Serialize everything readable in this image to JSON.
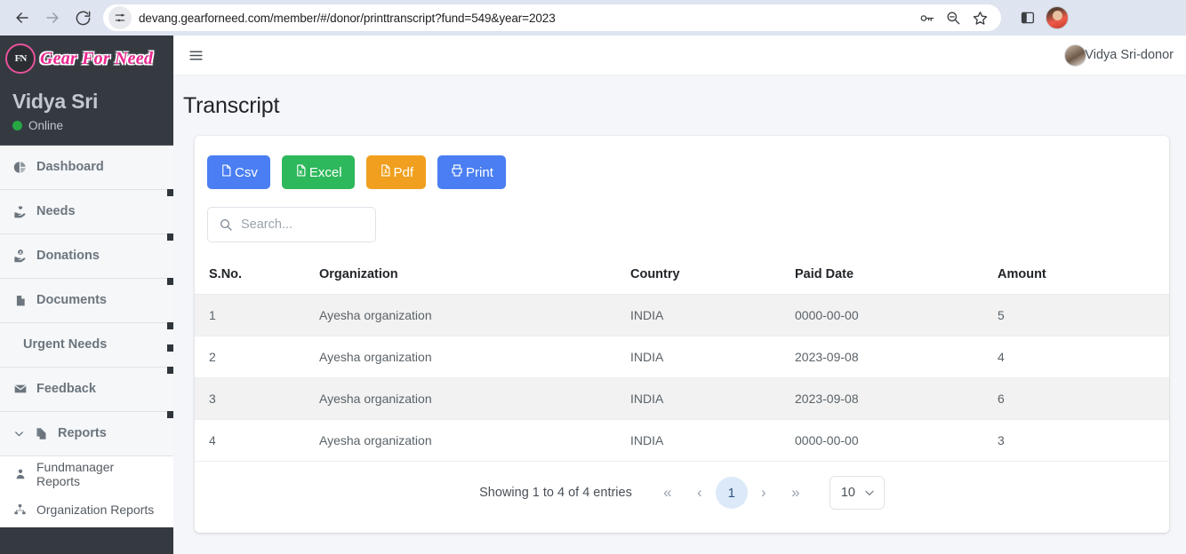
{
  "browser": {
    "url": "devang.gearforneed.com/member/#/donor/printtranscript?fund=549&year=2023",
    "back_icon": "back-arrow-icon",
    "forward_icon": "forward-arrow-icon",
    "reload_icon": "reload-icon",
    "site_settings_icon": "site-settings-icon",
    "password_icon": "password-key-icon",
    "zoom_icon": "zoom-icon",
    "bookmark_icon": "bookmark-star-icon",
    "sidepanel_icon": "side-panel-icon",
    "profile_icon": "profile-avatar-icon"
  },
  "sidebar": {
    "brand": {
      "badge": "FN",
      "name": "Gear For Need"
    },
    "user": {
      "name": "Vidya Sri",
      "status": "Online"
    },
    "items": [
      {
        "label": "Dashboard",
        "icon": "pie-chart-icon",
        "type": "item"
      },
      {
        "label": "Needs",
        "icon": "hand-holding-heart-icon",
        "type": "item"
      },
      {
        "label": "Donations",
        "icon": "hand-holding-dollar-icon",
        "type": "item"
      },
      {
        "label": "Documents",
        "icon": "file-icon",
        "type": "item"
      },
      {
        "label": "Urgent Needs",
        "icon": "",
        "type": "item"
      },
      {
        "label": "Feedback",
        "icon": "envelope-icon",
        "type": "item"
      },
      {
        "label": "Reports",
        "icon": "copy-files-icon",
        "type": "group",
        "expanded": true
      },
      {
        "label": "Fundmanager Reports",
        "icon": "user-tie-icon",
        "type": "sub"
      },
      {
        "label": "Organization Reports",
        "icon": "sitemap-icon",
        "type": "sub"
      }
    ]
  },
  "topbar": {
    "menu_icon": "hamburger-menu-icon",
    "user_label": "Vidya Sri-donor",
    "avatar_icon": "user-avatar-icon"
  },
  "page": {
    "title": "Transcript"
  },
  "toolbar": {
    "buttons": [
      {
        "label": "Csv",
        "icon": "file-csv-icon",
        "color": "#4a7ef2"
      },
      {
        "label": "Excel",
        "icon": "file-excel-icon",
        "color": "#2eb85c"
      },
      {
        "label": "Pdf",
        "icon": "file-pdf-icon",
        "color": "#f0a01e"
      },
      {
        "label": "Print",
        "icon": "printer-icon",
        "color": "#4a7ef2"
      }
    ]
  },
  "search": {
    "placeholder": "Search...",
    "value": "",
    "icon": "search-icon"
  },
  "table": {
    "columns": [
      "S.No.",
      "Organization",
      "Country",
      "Paid Date",
      "Amount"
    ],
    "rows": [
      {
        "sno": "1",
        "organization": "Ayesha organization",
        "country": "INDIA",
        "paid_date": "0000-00-00",
        "amount": "5"
      },
      {
        "sno": "2",
        "organization": "Ayesha organization",
        "country": "INDIA",
        "paid_date": "2023-09-08",
        "amount": "4"
      },
      {
        "sno": "3",
        "organization": "Ayesha organization",
        "country": "INDIA",
        "paid_date": "2023-09-08",
        "amount": "6"
      },
      {
        "sno": "4",
        "organization": "Ayesha organization",
        "country": "INDIA",
        "paid_date": "0000-00-00",
        "amount": "3"
      }
    ]
  },
  "pagination": {
    "showing": "Showing 1 to 4 of 4 entries",
    "first": "«",
    "prev": "‹",
    "current_page": "1",
    "next": "›",
    "last": "»",
    "per_page": "10",
    "per_page_chevron": "chevron-down-icon"
  },
  "colors": {
    "sidebar_bg": "#343a40",
    "accent_blue": "#4a7ef2",
    "accent_green": "#2eb85c",
    "accent_orange": "#f0a01e",
    "brand_pink": "#ec268f",
    "online_green": "#28a745",
    "page_bg": "#f4f6f9",
    "active_page_bg": "#dbe9f8"
  }
}
